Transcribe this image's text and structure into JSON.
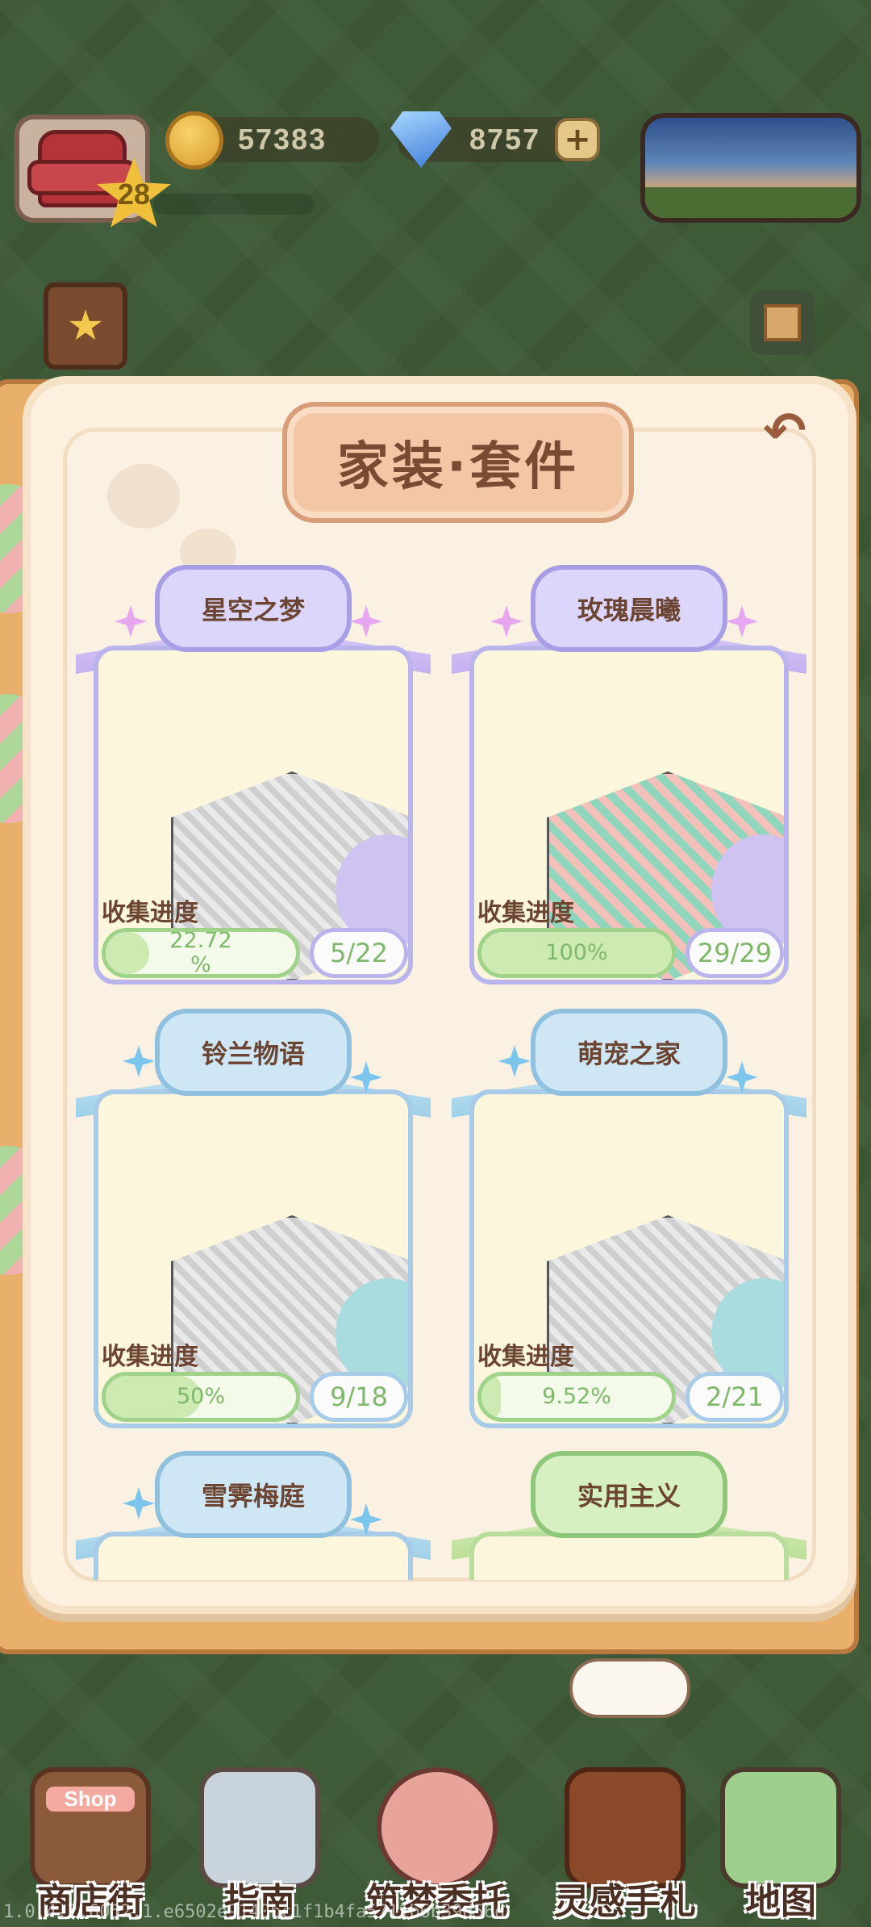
{
  "hud": {
    "level": "28",
    "coins": "57383",
    "gems": "8757",
    "add_symbol": "+"
  },
  "panel": {
    "title": "家装·套件",
    "back_symbol": "↶"
  },
  "sets": [
    {
      "name": "星空之梦",
      "progress_label": "收集进度",
      "progress_text": "22.72\n%",
      "progress_value": 22.72,
      "count": "5/22",
      "theme": "purple"
    },
    {
      "name": "玫瑰晨曦",
      "progress_label": "收集进度",
      "progress_text": "100%",
      "progress_value": 100,
      "count": "29/29",
      "theme": "purple"
    },
    {
      "name": "铃兰物语",
      "progress_label": "收集进度",
      "progress_text": "50%",
      "progress_value": 50,
      "count": "9/18",
      "theme": "blue"
    },
    {
      "name": "萌宠之家",
      "progress_label": "收集进度",
      "progress_text": "9.52%",
      "progress_value": 9.52,
      "count": "2/21",
      "theme": "blue"
    },
    {
      "name": "雪霁梅庭",
      "theme": "blue"
    },
    {
      "name": "实用主义",
      "theme": "green"
    }
  ],
  "bottom_nav": [
    {
      "label": "商店街",
      "icon": "shop-icon",
      "badge": "Shop"
    },
    {
      "label": "指南",
      "icon": "guide-icon"
    },
    {
      "label": "筑梦委托",
      "icon": "commission-icon"
    },
    {
      "label": "灵感手札",
      "icon": "notebook-icon"
    },
    {
      "label": "地图",
      "icon": "map-icon"
    }
  ],
  "version": "1.0.4.2.6052.1.e6502e9140bc1f1b4fa5711b6b39d56d"
}
